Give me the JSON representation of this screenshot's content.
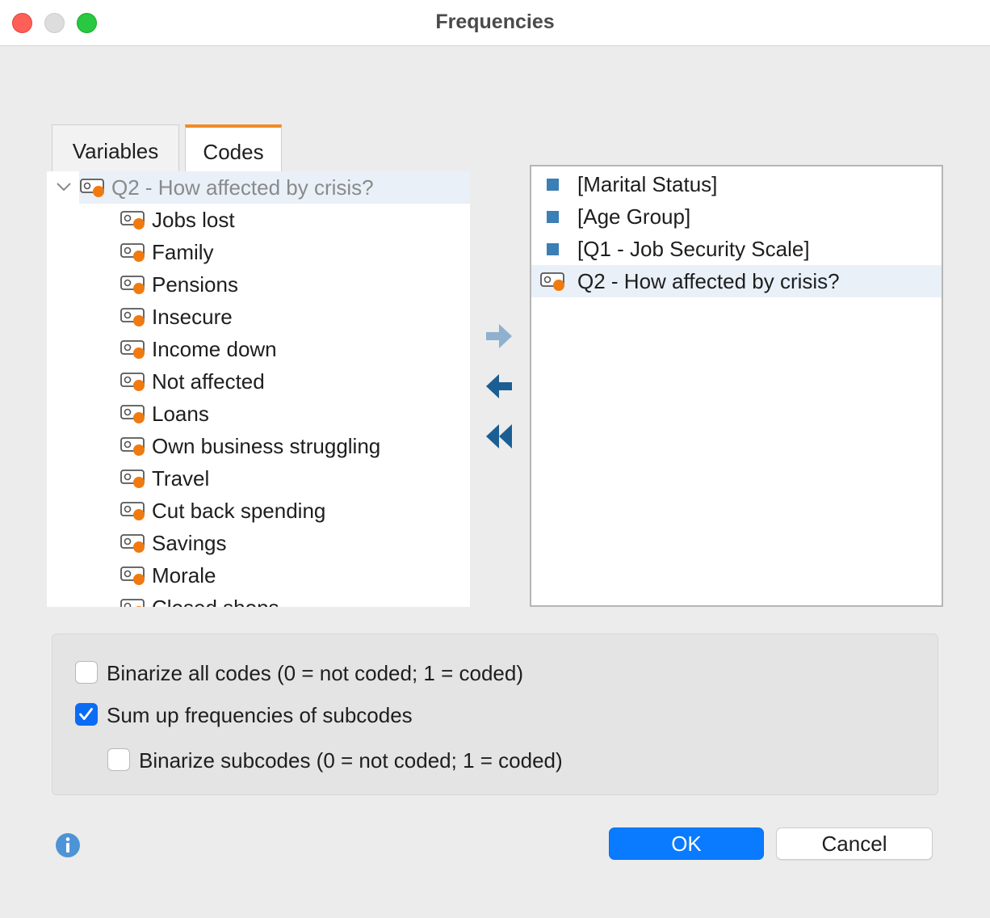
{
  "window": {
    "title": "Frequencies"
  },
  "tabs": [
    {
      "label": "Variables",
      "active": false
    },
    {
      "label": "Codes",
      "active": true
    }
  ],
  "tree": {
    "root": {
      "label": "Q2 - How affected by crisis?",
      "icon": "code-icon"
    },
    "children": [
      {
        "label": "Jobs lost"
      },
      {
        "label": "Family"
      },
      {
        "label": "Pensions"
      },
      {
        "label": "Insecure"
      },
      {
        "label": "Income down"
      },
      {
        "label": "Not affected"
      },
      {
        "label": "Loans"
      },
      {
        "label": "Own business struggling"
      },
      {
        "label": "Travel"
      },
      {
        "label": "Cut back spending"
      },
      {
        "label": "Savings"
      },
      {
        "label": "Morale"
      },
      {
        "label": "Closed shops"
      }
    ]
  },
  "transfer_buttons": [
    "arrow-right-icon",
    "arrow-left-icon",
    "double-arrow-left-icon"
  ],
  "selected_list": [
    {
      "label": "[Marital Status]",
      "type": "variable"
    },
    {
      "label": "[Age Group]",
      "type": "variable"
    },
    {
      "label": "[Q1 - Job Security Scale]",
      "type": "variable"
    },
    {
      "label": "Q2 - How affected by crisis?",
      "type": "code",
      "selected": true
    }
  ],
  "options": {
    "binarize_all": {
      "label": "Binarize all codes (0 = not coded; 1 = coded)",
      "checked": false
    },
    "sum_up": {
      "label": "Sum up frequencies of subcodes",
      "checked": true
    },
    "binarize_sub": {
      "label": "Binarize subcodes (0 = not coded; 1 = coded)",
      "checked": false
    }
  },
  "buttons": {
    "ok": "OK",
    "cancel": "Cancel"
  },
  "colors": {
    "accent": "#0a7bff",
    "code_dot": "#f07a10",
    "variable_square": "#3a7fb5",
    "tab_highlight": "#f08a24"
  }
}
